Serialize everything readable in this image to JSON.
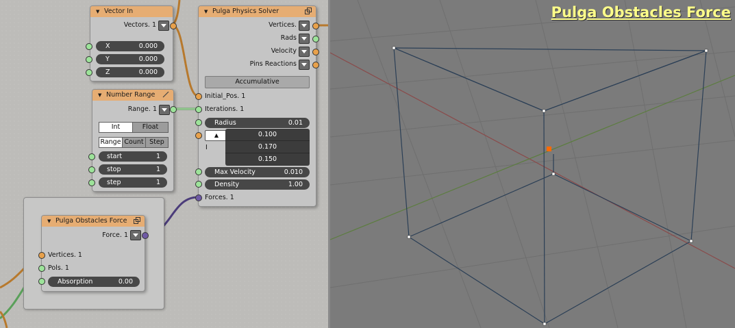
{
  "viewport": {
    "title": "Pulga Obstacles Force",
    "title_color": "#ffff8a"
  },
  "colors": {
    "header": "#e6ad73",
    "socket_green": "#9de39a",
    "socket_orange": "#e8a14b",
    "socket_purple": "#6f5aa5",
    "cube_edge": "#2b3f56",
    "x_axis": "#8a4a4a",
    "y_axis": "#5c7d3f"
  },
  "vector_in": {
    "title": "Vector In",
    "output": "Vectors. 1",
    "fields": [
      {
        "label": "X",
        "value": "0.000"
      },
      {
        "label": "Y",
        "value": "0.000"
      },
      {
        "label": "Z",
        "value": "0.000"
      }
    ]
  },
  "number_range": {
    "title": "Number Range",
    "output": "Range. 1",
    "type_options": [
      "Int",
      "Float"
    ],
    "mode_options": [
      "Range",
      "Count",
      "Step"
    ],
    "fields": [
      {
        "label": "start",
        "value": "1"
      },
      {
        "label": "stop",
        "value": "1"
      },
      {
        "label": "step",
        "value": "1"
      }
    ]
  },
  "solver": {
    "title": "Pulga Physics Solver",
    "outputs": [
      "Vertices.",
      "Rads",
      "Velocity",
      "Pins Reactions"
    ],
    "accumulative": "Accumulative",
    "initial_pos": "Initial_Pos. 1",
    "iterations": "Iterations. 1",
    "radius": {
      "label": "Radius",
      "value": "0.01"
    },
    "popup_values": [
      "0.100",
      "0.170",
      "0.150"
    ],
    "max_velocity": {
      "label": "Max Velocity",
      "value": "0.010"
    },
    "density": {
      "label": "Density",
      "value": "1.00"
    },
    "forces": "Forces. 1"
  },
  "obstacles": {
    "title": "Pulga Obstacles Force",
    "output": "Force. 1",
    "inputs": [
      "Vertices. 1",
      "Pols. 1"
    ],
    "absorption": {
      "label": "Absorption",
      "value": "0.00"
    }
  }
}
